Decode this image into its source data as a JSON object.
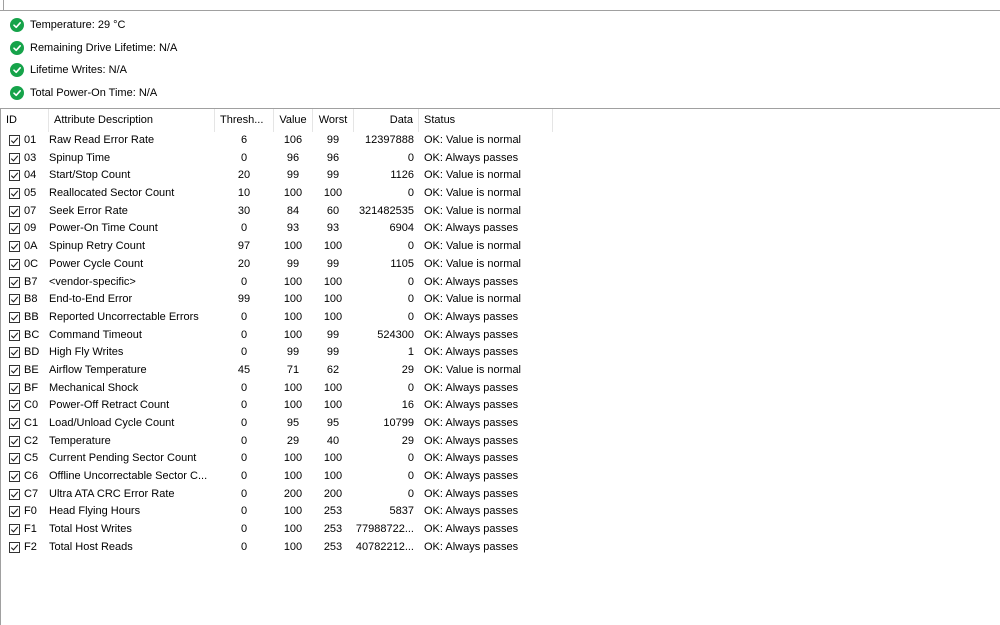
{
  "summary": [
    {
      "text": "Temperature: 29 °C"
    },
    {
      "text": "Remaining Drive Lifetime: N/A"
    },
    {
      "text": "Lifetime Writes: N/A"
    },
    {
      "text": "Total Power-On Time: N/A"
    }
  ],
  "colors": {
    "ok_green": "#16a34a",
    "divider": "#a0a0a0"
  },
  "table": {
    "columns": {
      "id": "ID",
      "description": "Attribute Description",
      "threshold": "Thresh...",
      "value": "Value",
      "worst": "Worst",
      "data": "Data",
      "status": "Status"
    },
    "rows": [
      {
        "id": "01",
        "description": "Raw Read Error Rate",
        "threshold": "6",
        "value": "106",
        "worst": "99",
        "data": "12397888",
        "status": "OK: Value is normal"
      },
      {
        "id": "03",
        "description": "Spinup Time",
        "threshold": "0",
        "value": "96",
        "worst": "96",
        "data": "0",
        "status": "OK: Always passes"
      },
      {
        "id": "04",
        "description": "Start/Stop Count",
        "threshold": "20",
        "value": "99",
        "worst": "99",
        "data": "1126",
        "status": "OK: Value is normal"
      },
      {
        "id": "05",
        "description": "Reallocated Sector Count",
        "threshold": "10",
        "value": "100",
        "worst": "100",
        "data": "0",
        "status": "OK: Value is normal"
      },
      {
        "id": "07",
        "description": "Seek Error Rate",
        "threshold": "30",
        "value": "84",
        "worst": "60",
        "data": "321482535",
        "status": "OK: Value is normal"
      },
      {
        "id": "09",
        "description": "Power-On Time Count",
        "threshold": "0",
        "value": "93",
        "worst": "93",
        "data": "6904",
        "status": "OK: Always passes"
      },
      {
        "id": "0A",
        "description": "Spinup Retry Count",
        "threshold": "97",
        "value": "100",
        "worst": "100",
        "data": "0",
        "status": "OK: Value is normal"
      },
      {
        "id": "0C",
        "description": "Power Cycle Count",
        "threshold": "20",
        "value": "99",
        "worst": "99",
        "data": "1105",
        "status": "OK: Value is normal"
      },
      {
        "id": "B7",
        "description": "<vendor-specific>",
        "threshold": "0",
        "value": "100",
        "worst": "100",
        "data": "0",
        "status": "OK: Always passes"
      },
      {
        "id": "B8",
        "description": "End-to-End Error",
        "threshold": "99",
        "value": "100",
        "worst": "100",
        "data": "0",
        "status": "OK: Value is normal"
      },
      {
        "id": "BB",
        "description": "Reported Uncorrectable Errors",
        "threshold": "0",
        "value": "100",
        "worst": "100",
        "data": "0",
        "status": "OK: Always passes"
      },
      {
        "id": "BC",
        "description": "Command Timeout",
        "threshold": "0",
        "value": "100",
        "worst": "99",
        "data": "524300",
        "status": "OK: Always passes"
      },
      {
        "id": "BD",
        "description": "High Fly Writes",
        "threshold": "0",
        "value": "99",
        "worst": "99",
        "data": "1",
        "status": "OK: Always passes"
      },
      {
        "id": "BE",
        "description": "Airflow Temperature",
        "threshold": "45",
        "value": "71",
        "worst": "62",
        "data": "29",
        "status": "OK: Value is normal"
      },
      {
        "id": "BF",
        "description": "Mechanical Shock",
        "threshold": "0",
        "value": "100",
        "worst": "100",
        "data": "0",
        "status": "OK: Always passes"
      },
      {
        "id": "C0",
        "description": "Power-Off Retract Count",
        "threshold": "0",
        "value": "100",
        "worst": "100",
        "data": "16",
        "status": "OK: Always passes"
      },
      {
        "id": "C1",
        "description": "Load/Unload Cycle Count",
        "threshold": "0",
        "value": "95",
        "worst": "95",
        "data": "10799",
        "status": "OK: Always passes"
      },
      {
        "id": "C2",
        "description": "Temperature",
        "threshold": "0",
        "value": "29",
        "worst": "40",
        "data": "29",
        "status": "OK: Always passes"
      },
      {
        "id": "C5",
        "description": "Current Pending Sector Count",
        "threshold": "0",
        "value": "100",
        "worst": "100",
        "data": "0",
        "status": "OK: Always passes"
      },
      {
        "id": "C6",
        "description": "Offline Uncorrectable Sector C...",
        "threshold": "0",
        "value": "100",
        "worst": "100",
        "data": "0",
        "status": "OK: Always passes"
      },
      {
        "id": "C7",
        "description": "Ultra ATA CRC Error Rate",
        "threshold": "0",
        "value": "200",
        "worst": "200",
        "data": "0",
        "status": "OK: Always passes"
      },
      {
        "id": "F0",
        "description": "Head Flying Hours",
        "threshold": "0",
        "value": "100",
        "worst": "253",
        "data": "5837",
        "status": "OK: Always passes"
      },
      {
        "id": "F1",
        "description": "Total Host Writes",
        "threshold": "0",
        "value": "100",
        "worst": "253",
        "data": "77988722...",
        "status": "OK: Always passes"
      },
      {
        "id": "F2",
        "description": "Total Host Reads",
        "threshold": "0",
        "value": "100",
        "worst": "253",
        "data": "40782212...",
        "status": "OK: Always passes"
      }
    ]
  }
}
